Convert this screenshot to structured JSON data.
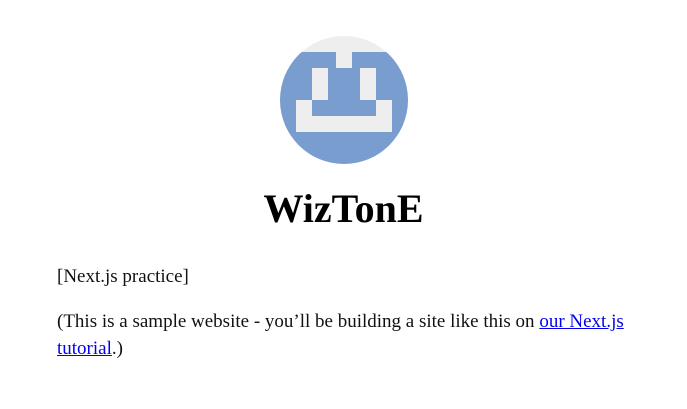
{
  "profile": {
    "name": "WizTonE",
    "avatar_colors": {
      "background": "#eeeeee",
      "shape": "#7a9dd0"
    }
  },
  "intro": {
    "tagline": "[Next.js practice]",
    "text_before_link": "(This is a sample website - you’ll be building a site like this on ",
    "link_text": "our Next.js tutorial",
    "text_after_link": ".)"
  }
}
